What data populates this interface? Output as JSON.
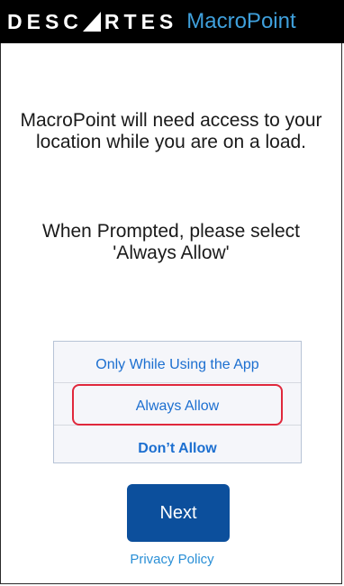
{
  "header": {
    "brand_left": "DESC",
    "brand_right_part": "RTES",
    "brand_secondary": "MacroPoint",
    "accent_color": "#3fa0dc"
  },
  "main": {
    "instruction_1": "MacroPoint will need access to your location while you are on a load.",
    "instruction_2": "When Prompted, please select 'Always Allow'"
  },
  "permission_dialog": {
    "options": [
      {
        "label": "Only While Using the App"
      },
      {
        "label": "Always Allow",
        "highlighted": true
      },
      {
        "label": "Don’t Allow"
      }
    ],
    "highlight_color": "#e0283c",
    "option_color": "#1c6fd0"
  },
  "actions": {
    "next_label": "Next",
    "next_color": "#0c4f9c",
    "privacy_label": "Privacy Policy"
  }
}
